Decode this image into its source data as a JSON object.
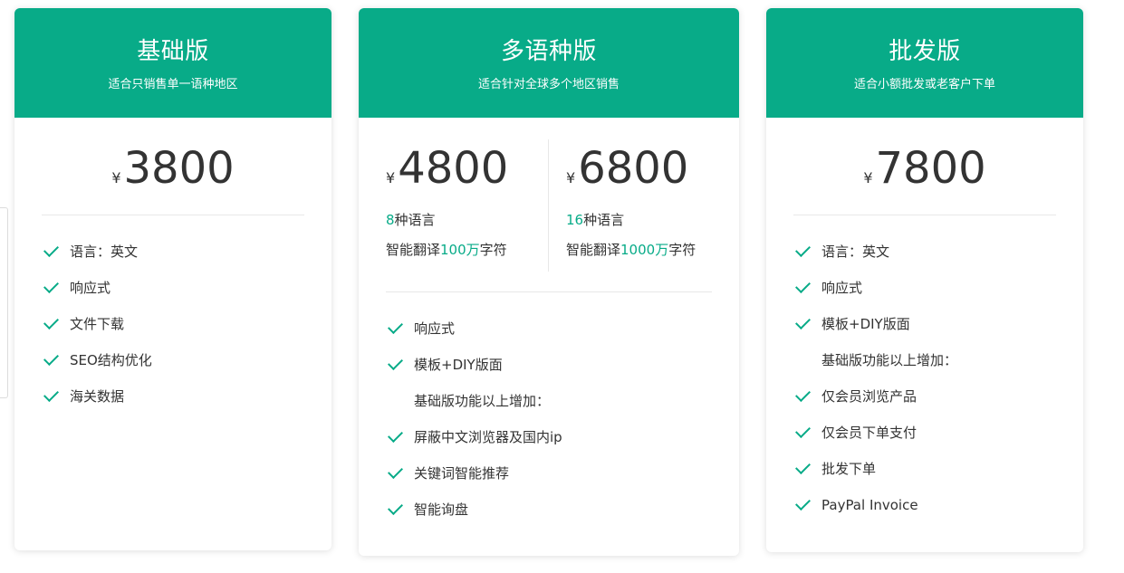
{
  "colors": {
    "accent": "#08ab88",
    "text": "#333333",
    "divider": "#e8e8e8"
  },
  "plans": {
    "basic": {
      "title": "基础版",
      "subtitle": "适合只销售单一语种地区",
      "currency": "¥",
      "price": "3800",
      "features": [
        "语言：英文",
        "响应式",
        "文件下载",
        "SEO结构优化",
        "海关数据"
      ]
    },
    "multi": {
      "title": "多语种版",
      "subtitle": "适合针对全球多个地区销售",
      "options": [
        {
          "currency": "¥",
          "price": "4800",
          "lang_count": "8",
          "lang_suffix": "种语言",
          "trans_prefix": "智能翻译",
          "trans_amount": "100万",
          "trans_suffix": "字符"
        },
        {
          "currency": "¥",
          "price": "6800",
          "lang_count": "16",
          "lang_suffix": "种语言",
          "trans_prefix": "智能翻译",
          "trans_amount": "1000万",
          "trans_suffix": "字符"
        }
      ],
      "features": [
        "响应式",
        "模板+DIY版面",
        "基础版功能以上增加：",
        "屏蔽中文浏览器及国内ip",
        "关键词智能推荐",
        "智能询盘"
      ]
    },
    "wholesale": {
      "title": "批发版",
      "subtitle": "适合小额批发或老客户下单",
      "currency": "¥",
      "price": "7800",
      "features": [
        "语言：英文",
        "响应式",
        "模板+DIY版面",
        "基础版功能以上增加：",
        "仅会员浏览产品",
        "仅会员下单支付",
        "批发下单",
        "PayPal Invoice"
      ]
    }
  }
}
